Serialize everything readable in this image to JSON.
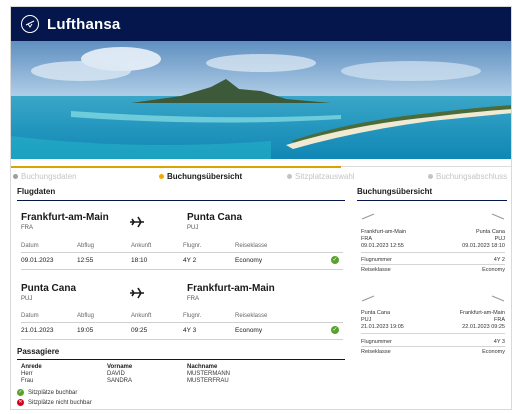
{
  "header": {
    "brand": "Lufthansa",
    "icon": "crane-logo-icon",
    "bg_color": "#05164d"
  },
  "steps": [
    {
      "label": "Buchungsdaten",
      "state": "done"
    },
    {
      "label": "Buchungsübersicht",
      "state": "active"
    },
    {
      "label": "Sitzplatzauswahl",
      "state": "upcoming"
    },
    {
      "label": "Buchungsabschluss",
      "state": "upcoming"
    }
  ],
  "flights_section": {
    "title": "Flugdaten"
  },
  "columns": {
    "date": "Datum",
    "departure": "Abflug",
    "arrival": "Ankunft",
    "flight_no": "Flugnr.",
    "class": "Reiseklasse"
  },
  "flights": [
    {
      "from_city": "Frankfurt-am-Main",
      "from_code": "FRA",
      "to_city": "Punta Cana",
      "to_code": "PUJ",
      "date": "09.01.2023",
      "departure": "12:55",
      "arrival": "18:10",
      "flight_no": "4Y 2",
      "class": "Economy"
    },
    {
      "from_city": "Punta Cana",
      "from_code": "PUJ",
      "to_city": "Frankfurt-am-Main",
      "to_code": "FRA",
      "date": "21.01.2023",
      "departure": "19:05",
      "arrival": "09:25",
      "flight_no": "4Y 3",
      "class": "Economy"
    }
  ],
  "passengers": {
    "title": "Passagiere",
    "headers": {
      "salutation": "Anrede",
      "first_name": "Vorname",
      "last_name": "Nachname"
    },
    "rows": [
      {
        "salutation": "Herr",
        "first_name": "DAVID",
        "last_name": "MUSTERMANN"
      },
      {
        "salutation": "Frau",
        "first_name": "SANDRA",
        "last_name": "MUSTERFRAU"
      }
    ]
  },
  "legend": {
    "bookable": "Sitzplätze buchbar",
    "not_bookable": "Sitzplätze nicht buchbar",
    "ok_color": "#5aa02c",
    "no_color": "#d0021b"
  },
  "summary": {
    "title": "Buchungsübersicht",
    "flight_no_label": "Flugnummer",
    "class_label": "Reiseklasse",
    "legs": [
      {
        "from_city": "Frankfurt-am-Main",
        "from_code": "FRA",
        "dep_dt": "09.01.2023 12:55",
        "to_city": "Punta Cana",
        "to_code": "PUJ",
        "arr_dt": "09.01.2023 18:10",
        "flight_no": "4Y 2",
        "class": "Economy"
      },
      {
        "from_city": "Punta Cana",
        "from_code": "PUJ",
        "dep_dt": "21.01.2023 19:05",
        "to_city": "Frankfurt-am-Main",
        "to_code": "FRA",
        "arr_dt": "22.01.2023 09:25",
        "flight_no": "4Y 3",
        "class": "Economy"
      }
    ]
  }
}
